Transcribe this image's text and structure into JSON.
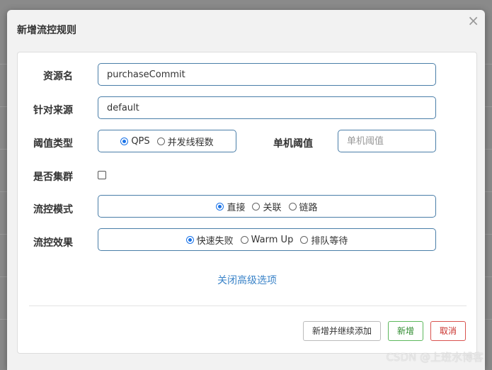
{
  "dialog": {
    "title": "新增流控规则",
    "close_glyph": "×"
  },
  "form": {
    "resource": {
      "label": "资源名",
      "value": "purchaseCommit"
    },
    "source": {
      "label": "针对来源",
      "value": "default"
    },
    "threshold_type": {
      "label": "阈值类型",
      "options": [
        "QPS",
        "并发线程数"
      ],
      "selected": "QPS"
    },
    "single_threshold": {
      "label": "单机阈值",
      "placeholder": "单机阈值"
    },
    "cluster": {
      "label": "是否集群",
      "checked": false
    },
    "flow_mode": {
      "label": "流控模式",
      "options": [
        "直接",
        "关联",
        "链路"
      ],
      "selected": "直接"
    },
    "flow_effect": {
      "label": "流控效果",
      "options": [
        "快速失败",
        "Warm Up",
        "排队等待"
      ],
      "selected": "快速失败"
    }
  },
  "advanced_toggle": "关闭高级选项",
  "buttons": {
    "add_continue": "新增并继续添加",
    "add": "新增",
    "cancel": "取消"
  },
  "watermark": "CSDN @上班水博客",
  "colors": {
    "accent": "#1a73e8",
    "link": "#3a83c8",
    "field_border": "#4a7ea8",
    "success": "#5cb85c",
    "danger": "#d9534f"
  }
}
